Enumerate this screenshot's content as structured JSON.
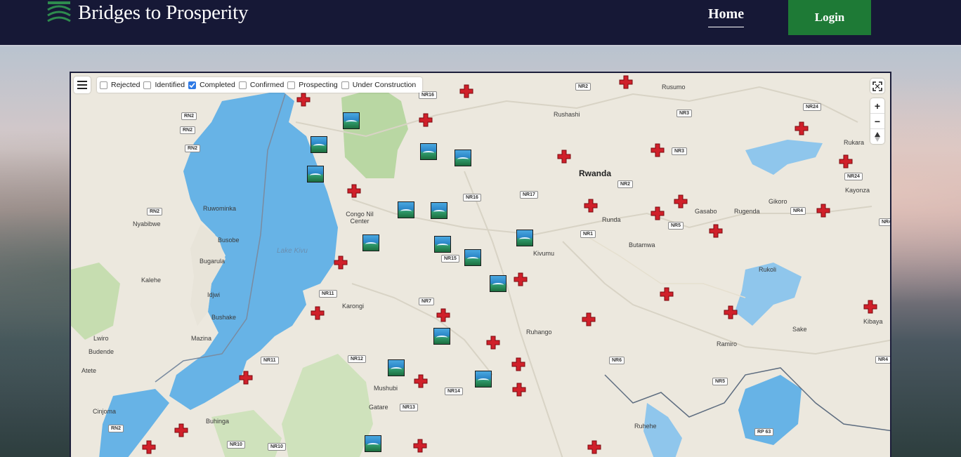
{
  "header": {
    "brand": "Bridges to Prosperity",
    "nav_home": "Home",
    "login": "Login"
  },
  "map": {
    "filters": [
      {
        "label": "Rejected",
        "checked": false
      },
      {
        "label": "Identified",
        "checked": false
      },
      {
        "label": "Completed",
        "checked": true
      },
      {
        "label": "Confirmed",
        "checked": false
      },
      {
        "label": "Prospecting",
        "checked": false
      },
      {
        "label": "Under Construction",
        "checked": false
      }
    ],
    "places": [
      "Rusumo",
      "Rushashi",
      "Rwanda",
      "Rukara",
      "Kayonza",
      "Gikoro",
      "Rugenda",
      "Gasabo",
      "Runda",
      "Congo Nil Center",
      "Nyabibwe",
      "Ruwominka",
      "Busobe",
      "Lake Kivu",
      "Kivumu",
      "Butamwa",
      "Bugarula",
      "Kalehe",
      "Idjwi",
      "Karongi",
      "Bushake",
      "Rukoli",
      "Kibaya",
      "Sake",
      "Ruhango",
      "Ramiro",
      "Mazina",
      "Lwiro",
      "Budende",
      "Atete",
      "Mushubi",
      "Gatare",
      "Cinjoma",
      "Buhinga",
      "Ruhehe"
    ],
    "roads": [
      "NR2",
      "NR16",
      "NR3",
      "NR24",
      "RN2",
      "RN2",
      "RN2",
      "NR3",
      "NR17",
      "NR16",
      "NR2",
      "NR24",
      "RN2",
      "NR4",
      "NR4",
      "NR5",
      "NR1",
      "NR15",
      "NR11",
      "NR7",
      "NR6",
      "NR4",
      "NR11",
      "NR12",
      "NR5",
      "NR14",
      "NR13",
      "RN2",
      "NR10",
      "NR10",
      "RP 63"
    ],
    "zoom_in": "+",
    "zoom_out": "−"
  }
}
